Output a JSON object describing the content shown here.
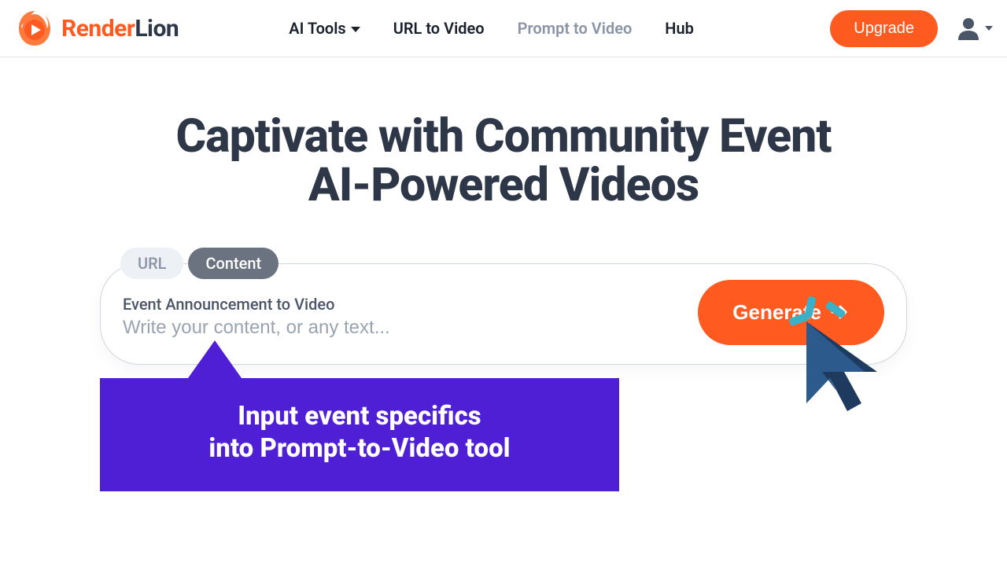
{
  "brand": {
    "name_a": "Render",
    "name_b": "Lion"
  },
  "nav": {
    "ai_tools": "AI Tools",
    "url_to_video": "URL to Video",
    "prompt_to_video": "Prompt to Video",
    "hub": "Hub"
  },
  "header": {
    "upgrade": "Upgrade"
  },
  "hero": {
    "line1": "Captivate with Community Event",
    "line2": "AI-Powered Videos"
  },
  "tabs": {
    "url": "URL",
    "content": "Content"
  },
  "panel": {
    "label": "Event Announcement to Video",
    "placeholder": "Write your content, or any text...",
    "button": "Generate"
  },
  "callout": {
    "line1": "Input event specifics",
    "line2": "into Prompt-to-Video tool"
  },
  "colors": {
    "accent": "#ff5a1f",
    "callout": "#4f1fd6",
    "text_dark": "#2d3748",
    "muted": "#8a94a6"
  }
}
